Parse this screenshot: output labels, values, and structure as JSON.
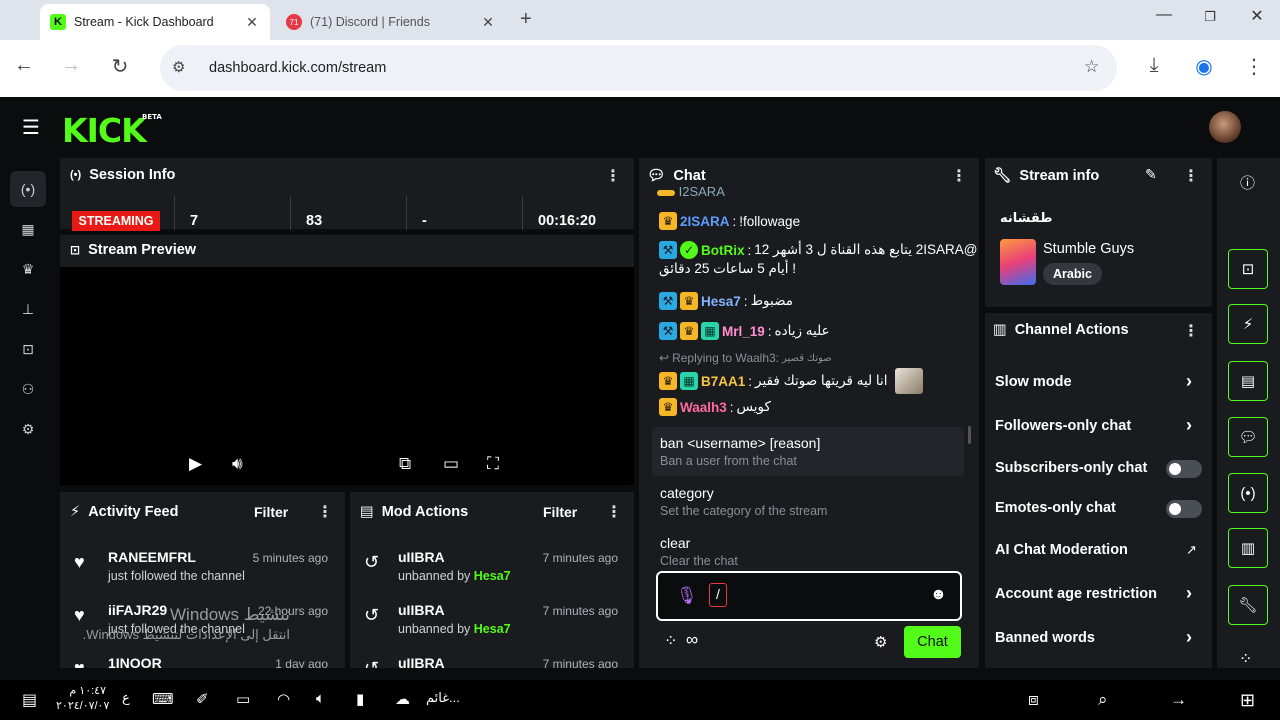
{
  "browser": {
    "tabs": [
      {
        "title": "Stream - Kick Dashboard",
        "favicon_color": "#53fc18",
        "active": true
      },
      {
        "title": "(71) Discord | Friends",
        "favicon_color": "#e53945",
        "favicon_text": "71",
        "active": false
      }
    ],
    "url": "dashboard.kick.com/stream"
  },
  "brand": {
    "logo": "KICK",
    "beta": "BETA",
    "accent": "#53fc18"
  },
  "session": {
    "title": "Session Info",
    "status": "STREAMING",
    "stats": [
      "7",
      "83",
      "-",
      "00:16:20"
    ]
  },
  "preview": {
    "title": "Stream Preview"
  },
  "activity": {
    "title": "Activity Feed",
    "filter": "Filter",
    "items": [
      {
        "name": "RANEEMFRL",
        "time": "5 minutes ago",
        "sub": "just followed the channel"
      },
      {
        "name": "iiFAJR29",
        "time": "22 hours ago",
        "sub": "just followed the channel"
      },
      {
        "name": "1INOOR",
        "time": "1 day ago",
        "sub": ""
      }
    ]
  },
  "mod": {
    "title": "Mod Actions",
    "filter": "Filter",
    "items": [
      {
        "name": "uIIBRA",
        "time": "7 minutes ago",
        "sub": "unbanned by",
        "by": "Hesa7"
      },
      {
        "name": "uIIBRA",
        "time": "7 minutes ago",
        "sub": "unbanned by",
        "by": "Hesa7"
      },
      {
        "name": "uIIBRA",
        "time": "7 minutes ago",
        "sub": "",
        "by": ""
      }
    ]
  },
  "chat": {
    "title": "Chat",
    "partial_top": "I2SARA",
    "messages": [
      {
        "user": "2ISARA",
        "color": "#5b9dff",
        "text": "!followage"
      },
      {
        "user": "BotRix",
        "color": "#53fc18",
        "text": "@2ISARA يتابع هذه القناة ل 3 أشهر 12",
        "text2": "أيام 5 ساعات 25 دقائق !"
      },
      {
        "user": "Hesa7",
        "color": "#82b4ff",
        "text": "مضبوط"
      },
      {
        "user": "Mrl_19",
        "color": "#ff8fd0",
        "text": "عليه زياده"
      },
      {
        "reply": "Replying to Waalh3:",
        "reply_text": "صوتك قصير"
      },
      {
        "user": "B7AA1",
        "color": "#f5c542",
        "text": "انا ليه قريتها صوتك فقير"
      },
      {
        "user": "Waalh3",
        "color": "#ff6b9b",
        "text": "كويس"
      }
    ],
    "commands": [
      {
        "cmd": "ban <username> [reason]",
        "desc": "Ban a user from the chat"
      },
      {
        "cmd": "category",
        "desc": "Set the category of the stream"
      },
      {
        "cmd": "clear",
        "desc": "Clear the chat"
      }
    ],
    "input_value": "/",
    "send_label": "Chat"
  },
  "stream_info": {
    "title": "Stream info",
    "stream_title": "طقشانه",
    "game": "Stumble Guys",
    "language": "Arabic"
  },
  "channel_actions": {
    "title": "Channel Actions",
    "items": [
      {
        "label": "Slow mode",
        "kind": "chevron"
      },
      {
        "label": "Followers-only chat",
        "kind": "chevron"
      },
      {
        "label": "Subscribers-only chat",
        "kind": "toggle"
      },
      {
        "label": "Emotes-only chat",
        "kind": "toggle"
      },
      {
        "label": "AI Chat Moderation",
        "kind": "external"
      },
      {
        "label": "Account age restriction",
        "kind": "chevron"
      },
      {
        "label": "Banned words",
        "kind": "chevron"
      }
    ]
  },
  "watermark": {
    "line1": "تنشيط Windows",
    "line2": "انتقل إلى الإعدادات لتنشيط Windows."
  },
  "taskbar": {
    "weather": "غائم...",
    "time": "١٠:٤٧ م",
    "date": "٢٠٢٤/٠٧/٠٧",
    "lang": "ع"
  }
}
